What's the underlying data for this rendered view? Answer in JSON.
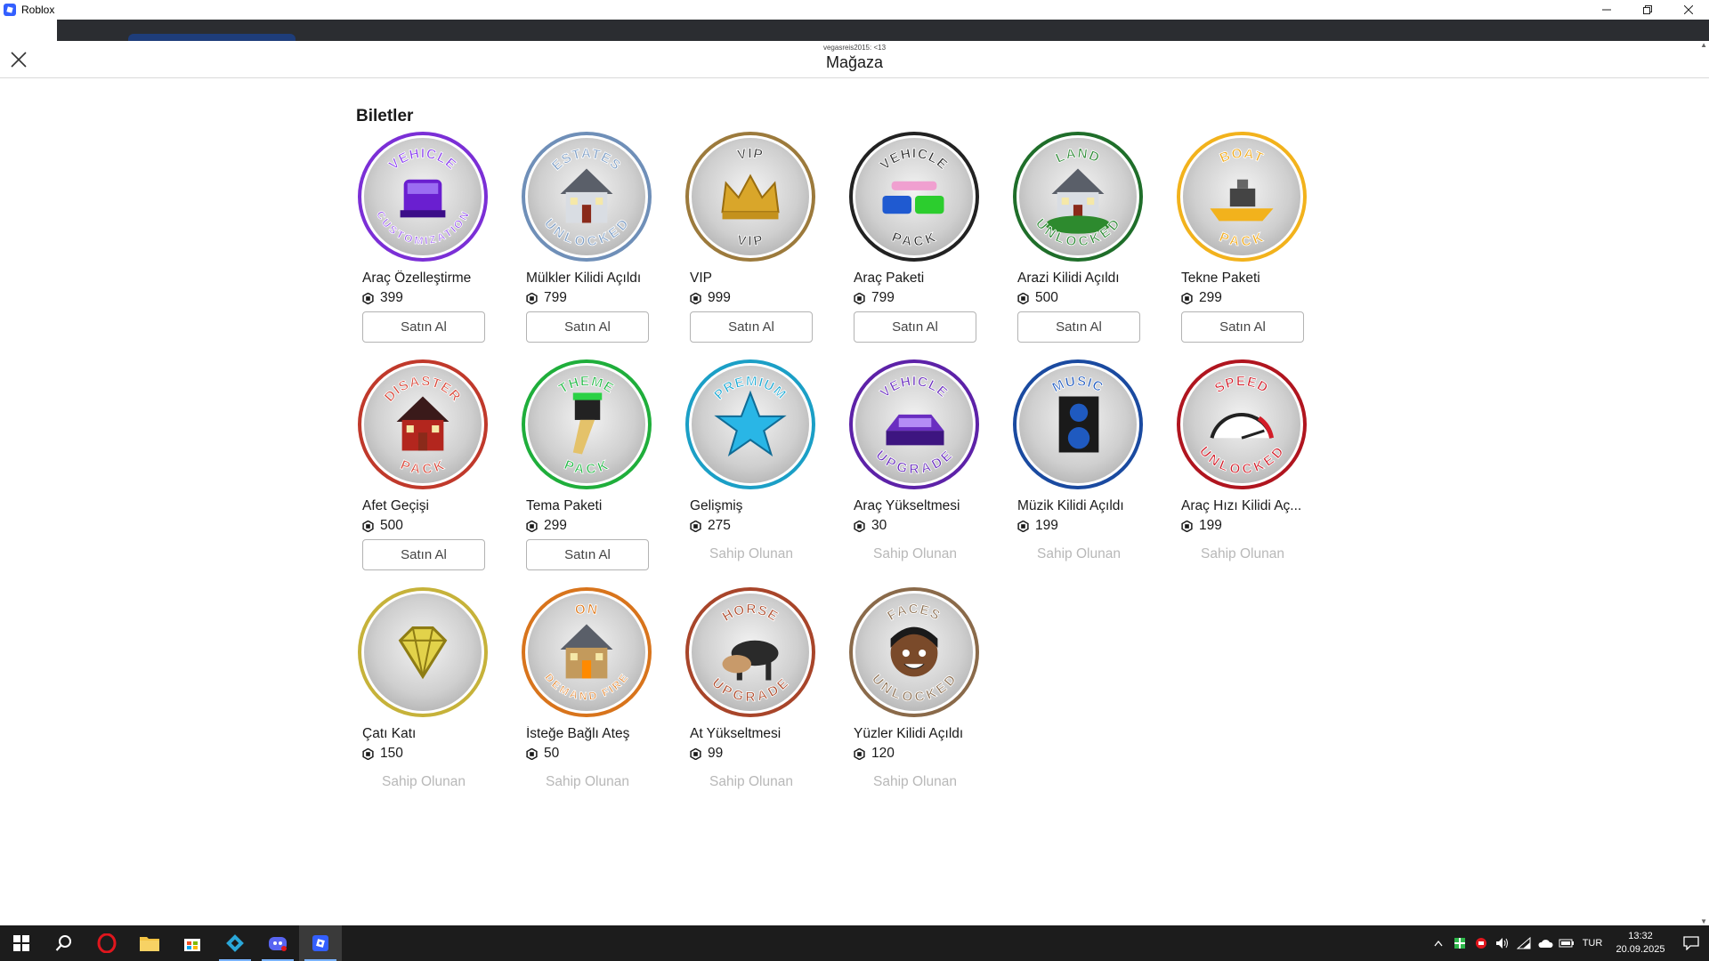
{
  "window": {
    "title": "Roblox"
  },
  "modal": {
    "player_line": "vegasreis2015: <13",
    "title": "Mağaza",
    "section_title": "Biletler"
  },
  "labels": {
    "buy": "Satın Al",
    "owned": "Sahip Olunan"
  },
  "items": [
    {
      "name": "Araç Özelleştirme",
      "price": "399",
      "owned": false,
      "ring": "#7b2fd6",
      "top": "VEHICLE",
      "bottom": "CUSTOMIZATION",
      "text_color": "#8a3ff0",
      "icon": "car-icon"
    },
    {
      "name": "Mülkler Kilidi Açıldı",
      "price": "799",
      "owned": false,
      "ring": "#6f8fb8",
      "top": "ESTATES",
      "bottom": "UNLOCKED",
      "text_color": "#7f9fc6",
      "icon": "house-icon"
    },
    {
      "name": "VIP",
      "price": "999",
      "owned": false,
      "ring": "#9c7a3c",
      "top": "VIP",
      "bottom": "VIP",
      "text_color": "#3a3a3a",
      "icon": "crown-icon"
    },
    {
      "name": "Araç Paketi",
      "price": "799",
      "owned": false,
      "ring": "#222222",
      "top": "VEHICLE",
      "bottom": "PACK",
      "text_color": "#2a2a2a",
      "icon": "cars-icon"
    },
    {
      "name": "Arazi Kilidi Açıldı",
      "price": "500",
      "owned": false,
      "ring": "#1f6e2a",
      "top": "LAND",
      "bottom": "UNLOCKED",
      "text_color": "#2e8a36",
      "icon": "land-icon"
    },
    {
      "name": "Tekne Paketi",
      "price": "299",
      "owned": false,
      "ring": "#f2b21c",
      "top": "BOAT",
      "bottom": "PACK",
      "text_color": "#f0a91a",
      "icon": "boat-icon"
    },
    {
      "name": "Afet Geçişi",
      "price": "500",
      "owned": false,
      "ring": "#c0392b",
      "top": "DISASTER",
      "bottom": "PACK",
      "text_color": "#d9483a",
      "icon": "disaster-house-icon"
    },
    {
      "name": "Tema Paketi",
      "price": "299",
      "owned": false,
      "ring": "#1fae3b",
      "top": "THEME",
      "bottom": "PACK",
      "text_color": "#22b845",
      "icon": "paintbrush-icon"
    },
    {
      "name": "Gelişmiş",
      "price": "275",
      "owned": true,
      "ring": "#1b9fc6",
      "top": "PREMIUM",
      "bottom": "",
      "text_color": "#1ba9d4",
      "icon": "star-icon"
    },
    {
      "name": "Araç Yükseltmesi",
      "price": "30",
      "owned": true,
      "ring": "#5d22a8",
      "top": "VEHICLE",
      "bottom": "UPGRADE",
      "text_color": "#6a2ec0",
      "icon": "car-upgrade-icon"
    },
    {
      "name": "Müzik Kilidi Açıldı",
      "price": "199",
      "owned": true,
      "ring": "#1a4aa0",
      "top": "MUSIC",
      "bottom": "",
      "text_color": "#1f5ac0",
      "icon": "speaker-icon"
    },
    {
      "name": "Araç Hızı Kilidi Aç...",
      "price": "199",
      "owned": true,
      "ring": "#b0151f",
      "top": "SPEED",
      "bottom": "UNLOCKED",
      "text_color": "#d31c28",
      "icon": "speedometer-icon"
    },
    {
      "name": "Çatı Katı",
      "price": "150",
      "owned": true,
      "ring": "#c6b23a",
      "top": "",
      "bottom": "",
      "text_color": "#c6b23a",
      "icon": "diamond-icon"
    },
    {
      "name": "İsteğe Bağlı Ateş",
      "price": "50",
      "owned": true,
      "ring": "#d8741c",
      "top": "ON",
      "bottom": "DEMAND FIRE",
      "text_color": "#e07a1c",
      "icon": "fireplace-icon"
    },
    {
      "name": "At Yükseltmesi",
      "price": "99",
      "owned": true,
      "ring": "#a8452a",
      "top": "HORSE",
      "bottom": "UPGRADE",
      "text_color": "#b04d2e",
      "icon": "horse-icon"
    },
    {
      "name": "Yüzler Kilidi Açıldı",
      "price": "120",
      "owned": true,
      "ring": "#8a6a4a",
      "top": "FACES",
      "bottom": "UNLOCKED",
      "text_color": "#8f7356",
      "icon": "face-icon"
    }
  ],
  "taskbar": {
    "language": "TUR",
    "time": "13:32",
    "date": "20.09.2025"
  }
}
